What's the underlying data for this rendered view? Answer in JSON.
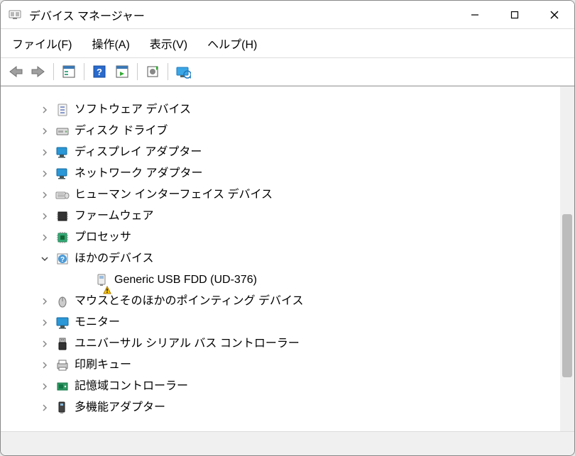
{
  "window": {
    "title": "デバイス マネージャー"
  },
  "menu": {
    "file": "ファイル(F)",
    "action": "操作(A)",
    "view": "表示(V)",
    "help": "ヘルプ(H)"
  },
  "tree": {
    "nodes": [
      {
        "label": "ソフトウェア デバイス",
        "icon": "software-device",
        "expanded": false,
        "hasChildren": true
      },
      {
        "label": "ディスク ドライブ",
        "icon": "disk-drive",
        "expanded": false,
        "hasChildren": true
      },
      {
        "label": "ディスプレイ アダプター",
        "icon": "display-adapter",
        "expanded": false,
        "hasChildren": true
      },
      {
        "label": "ネットワーク アダプター",
        "icon": "network-adapter",
        "expanded": false,
        "hasChildren": true
      },
      {
        "label": "ヒューマン インターフェイス デバイス",
        "icon": "hid",
        "expanded": false,
        "hasChildren": true
      },
      {
        "label": "ファームウェア",
        "icon": "firmware",
        "expanded": false,
        "hasChildren": true
      },
      {
        "label": "プロセッサ",
        "icon": "processor",
        "expanded": false,
        "hasChildren": true
      },
      {
        "label": "ほかのデバイス",
        "icon": "other-devices",
        "expanded": true,
        "hasChildren": true,
        "children": [
          {
            "label": "Generic USB FDD (UD-376)",
            "icon": "unknown-device-warning"
          }
        ]
      },
      {
        "label": "マウスとそのほかのポインティング デバイス",
        "icon": "mouse",
        "expanded": false,
        "hasChildren": true
      },
      {
        "label": "モニター",
        "icon": "monitor",
        "expanded": false,
        "hasChildren": true
      },
      {
        "label": "ユニバーサル シリアル バス コントローラー",
        "icon": "usb-controller",
        "expanded": false,
        "hasChildren": true
      },
      {
        "label": "印刷キュー",
        "icon": "print-queue",
        "expanded": false,
        "hasChildren": true
      },
      {
        "label": "記憶域コントローラー",
        "icon": "storage-controller",
        "expanded": false,
        "hasChildren": true
      },
      {
        "label": "多機能アダプター",
        "icon": "multifunction-adapter",
        "expanded": false,
        "hasChildren": true
      }
    ]
  }
}
